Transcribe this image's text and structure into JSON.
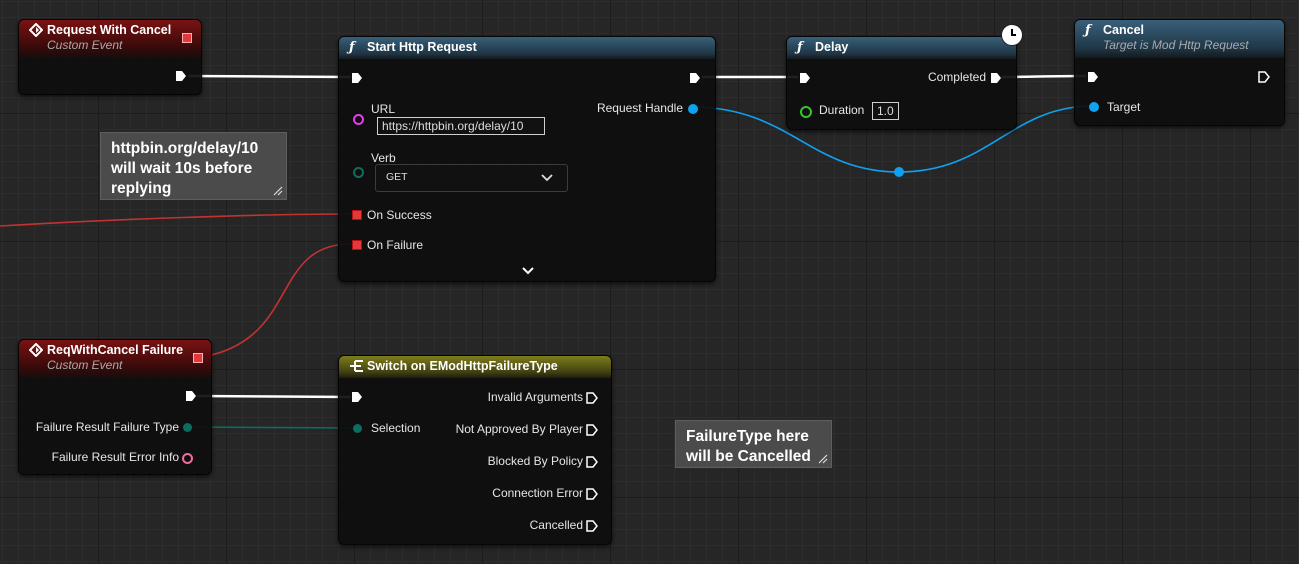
{
  "nodes": {
    "request_with_cancel": {
      "title": "Request With Cancel",
      "subtitle": "Custom Event"
    },
    "start_http_request": {
      "title": "Start Http Request",
      "url_label": "URL",
      "url_value": "https://httpbin.org/delay/10",
      "verb_label": "Verb",
      "verb_value": "GET",
      "request_handle_label": "Request Handle",
      "on_success_label": "On Success",
      "on_failure_label": "On Failure"
    },
    "delay": {
      "title": "Delay",
      "completed_label": "Completed",
      "duration_label": "Duration",
      "duration_value": "1.0"
    },
    "cancel": {
      "title": "Cancel",
      "subtitle": "Target is Mod Http Request",
      "target_label": "Target"
    },
    "req_with_cancel_failure": {
      "title": "ReqWithCancel Failure",
      "subtitle": "Custom Event",
      "failure_type_label": "Failure Result Failure Type",
      "error_info_label": "Failure Result Error Info"
    },
    "switch": {
      "title": "Switch on EModHttpFailureType",
      "selection_label": "Selection",
      "outputs": [
        "Invalid Arguments",
        "Not Approved By Player",
        "Blocked By Policy",
        "Connection Error",
        "Cancelled"
      ]
    }
  },
  "comments": {
    "delay_note": "httpbin.org/delay/10 will wait 10s before replying",
    "failure_note": "FailureType here will be Cancelled"
  },
  "colors": {
    "exec": "#ffffff",
    "delegate": "#e23a3a",
    "object": "#0ea2f0",
    "enum": "#0b6d60",
    "string": "#e23fe6",
    "float": "#37c62a",
    "struct": "#ec6e9e"
  },
  "icons": {
    "event": "event-diamond-icon",
    "function": "function-f-icon",
    "switch": "switch-icon",
    "latent": "clock-icon",
    "expand": "chevron-down-icon"
  }
}
